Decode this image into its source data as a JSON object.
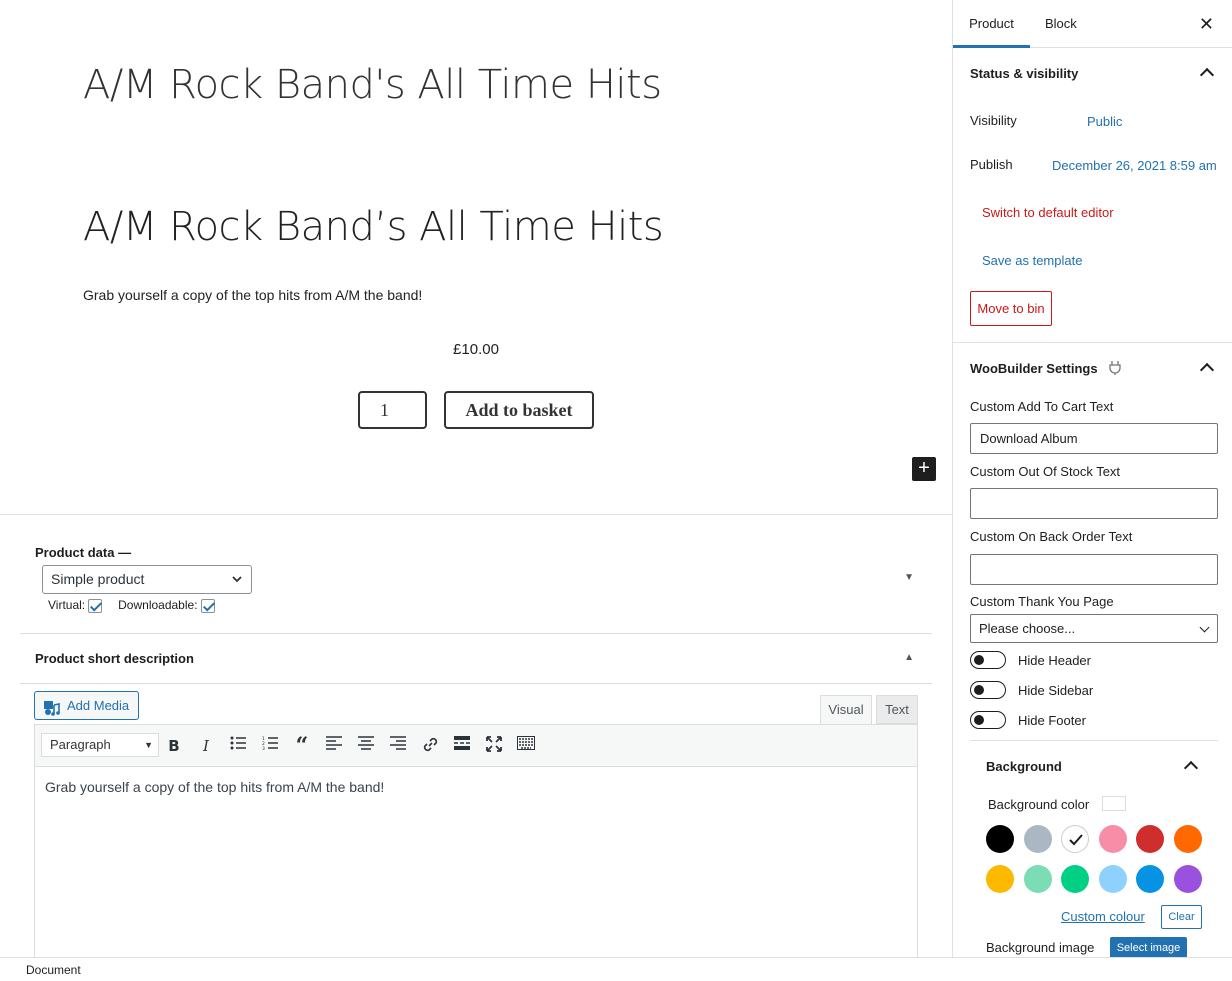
{
  "editor": {
    "post_title": "A/M Rock Band's All Time Hits",
    "product_title": "A/M Rock Band’s All Time Hits",
    "product_description": "Grab yourself a copy of the top hits from A/M the band!",
    "price": "£10.00",
    "quantity": "1",
    "add_to_basket": "Add to basket",
    "add_block": "+"
  },
  "product_data": {
    "label": "Product data —",
    "type_selected": "Simple product",
    "virtual_label": "Virtual:",
    "virtual_checked": true,
    "downloadable_label": "Downloadable:",
    "downloadable_checked": true,
    "toggle": "▼"
  },
  "short_description": {
    "label": "Product short description",
    "toggle": "▲",
    "add_media": "Add Media",
    "tab_visual": "Visual",
    "tab_text": "Text",
    "format_selected": "Paragraph",
    "content": "Grab yourself a copy of the top hits from A/M the band!"
  },
  "toolbar_icons": [
    "bold-icon",
    "italic-icon",
    "bullet-list-icon",
    "numbered-list-icon",
    "blockquote-icon",
    "align-left-icon",
    "align-center-icon",
    "align-right-icon",
    "link-icon",
    "read-more-icon",
    "fullscreen-icon",
    "toolbar-toggle-icon"
  ],
  "footer": {
    "breadcrumb": "Document"
  },
  "sidebar": {
    "tab_product": "Product",
    "tab_block": "Block",
    "close": "✕",
    "status_title": "Status & visibility",
    "visibility_label": "Visibility",
    "visibility_value": "Public",
    "publish_label": "Publish",
    "publish_value": "December 26, 2021 8:59 am",
    "switch_editor": "Switch to default editor",
    "save_template": "Save as template",
    "move_to_bin": "Move to bin",
    "woobuilder_title": "WooBuilder Settings",
    "add_to_cart_label": "Custom Add To Cart Text",
    "add_to_cart_value": "Download Album",
    "out_of_stock_label": "Custom Out Of Stock Text",
    "out_of_stock_value": "",
    "back_order_label": "Custom On Back Order Text",
    "back_order_value": "",
    "thank_you_label": "Custom Thank You Page",
    "thank_you_value": "Please choose...",
    "hide_header": "Hide Header",
    "hide_sidebar": "Hide Sidebar",
    "hide_footer": "Hide Footer",
    "background_title": "Background",
    "background_color_label": "Background color",
    "swatches": [
      "#000000",
      "#abb8c3",
      "#ffffff",
      "#f78da7",
      "#cf2e2e",
      "#ff6900",
      "#fcb900",
      "#7bdcb5",
      "#00d084",
      "#8ed1fc",
      "#0693e3",
      "#9b51e0"
    ],
    "selected_swatch": "#ffffff",
    "custom_colour": "Custom colour",
    "clear": "Clear",
    "background_image_label": "Background image",
    "select_image": "Select image"
  }
}
